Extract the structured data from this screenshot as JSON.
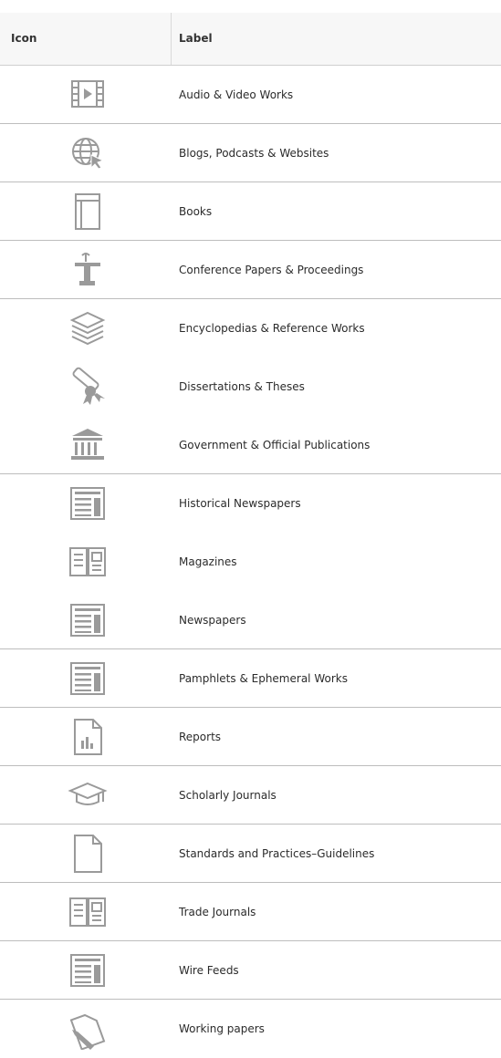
{
  "header": {
    "icon_col": "Icon",
    "label_col": "Label"
  },
  "rows": [
    {
      "label": "Audio & Video Works",
      "icon": "film-icon"
    },
    {
      "label": "Blogs, Podcasts & Websites",
      "icon": "globe-cursor-icon"
    },
    {
      "label": "Books",
      "icon": "book-icon"
    },
    {
      "label": "Conference Papers & Proceedings",
      "icon": "lectern-icon"
    },
    {
      "label": "Encyclopedias & Reference Works",
      "icon": "stacked-layers-icon"
    },
    {
      "label": "Dissertations & Theses",
      "icon": "diploma-ribbon-icon"
    },
    {
      "label": "Government & Official Publications",
      "icon": "government-building-icon"
    },
    {
      "label": "Historical Newspapers",
      "icon": "newspaper-icon"
    },
    {
      "label": "Magazines",
      "icon": "open-magazine-icon"
    },
    {
      "label": "Newspapers",
      "icon": "newspaper-icon"
    },
    {
      "label": "Pamphlets & Ephemeral Works",
      "icon": "newspaper-icon"
    },
    {
      "label": "Reports",
      "icon": "report-chart-icon"
    },
    {
      "label": "Scholarly Journals",
      "icon": "graduation-cap-icon"
    },
    {
      "label": "Standards and Practices–Guidelines",
      "icon": "blank-document-icon"
    },
    {
      "label": "Trade Journals",
      "icon": "open-magazine-icon"
    },
    {
      "label": "Wire Feeds",
      "icon": "newspaper-icon"
    },
    {
      "label": "Working papers",
      "icon": "document-pencil-icon"
    }
  ]
}
